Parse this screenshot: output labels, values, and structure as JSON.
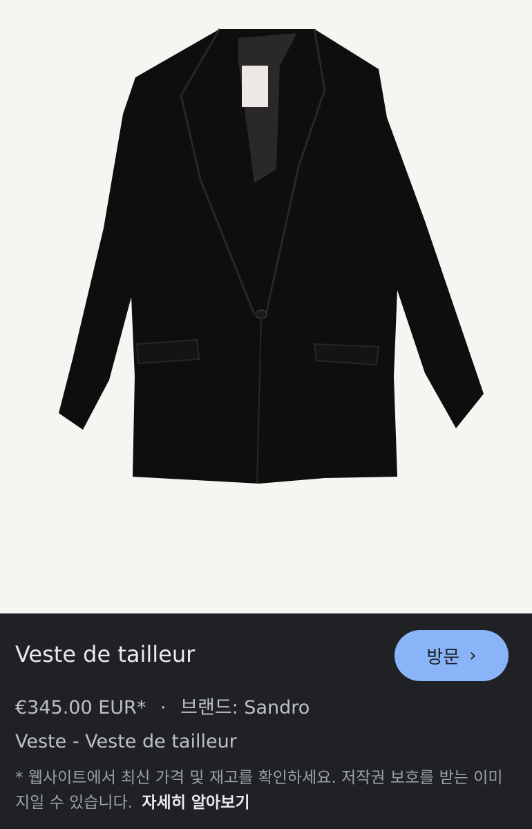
{
  "product": {
    "title": "Veste de tailleur",
    "price": "€345.00 EUR*",
    "separator": "·",
    "brand_label": "브랜드: Sandro",
    "subtitle": "Veste - Veste de tailleur",
    "notice": "* 웹사이트에서 최신 가격 및 재고를 확인하세요. 저작권 보호를 받는 이미지일 수 있습니다.",
    "learn_more": "자세히 알아보기"
  },
  "actions": {
    "visit_label": "방문",
    "visit_icon": "chevron-right-icon"
  },
  "colors": {
    "panel_background": "#202124",
    "button_background": "#8ab4f8",
    "image_background": "#f6f5f2",
    "garment": "#0f0d0d"
  }
}
